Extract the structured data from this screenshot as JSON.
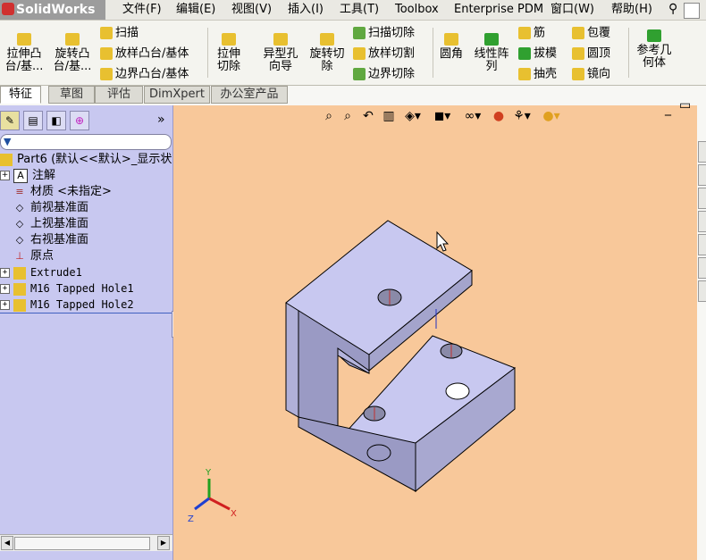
{
  "app": {
    "name": "SolidWorks"
  },
  "menu": [
    "文件(F)",
    "编辑(E)",
    "视图(V)",
    "插入(I)",
    "工具(T)",
    "Toolbox",
    "Enterprise PDM",
    "窗口(W)",
    "帮助(H)"
  ],
  "toolbar": {
    "extrude_boss": "拉伸凸台/基...",
    "revolve_boss": "旋转凸台/基...",
    "sweep": "扫描",
    "loft_boss": "放样凸台/基体",
    "boundary_boss": "边界凸台/基体",
    "extrude_cut": "拉伸切除",
    "hole_wizard": "异型孔向导",
    "revolve_cut": "旋转切除",
    "swept_cut": "扫描切除",
    "lofted_cut": "放样切割",
    "boundary_cut": "边界切除",
    "fillet": "圆角",
    "linear_pattern": "线性阵列",
    "rib": "筋",
    "draft": "拔模",
    "shell": "抽壳",
    "wrap": "包覆",
    "dome": "圆顶",
    "mirror": "镜向",
    "ref_geometry": "参考几何体"
  },
  "tabs": [
    "特征",
    "草图",
    "评估",
    "DimXpert",
    "办公室产品"
  ],
  "feature_tree": {
    "part": "Part6 (默认<<默认>_显示状",
    "items": [
      "注解",
      "材质 <未指定>",
      "前视基准面",
      "上视基准面",
      "右视基准面",
      "原点",
      "Extrude1",
      "M16 Tapped Hole1",
      "M16 Tapped Hole2"
    ]
  },
  "triad": {
    "x": "X",
    "y": "Y",
    "z": "Z"
  },
  "colors": {
    "viewport": "#f8c89a",
    "panel": "#c8c8f0",
    "model": "#c8c8f0",
    "model_side": "#9a9ac4"
  }
}
